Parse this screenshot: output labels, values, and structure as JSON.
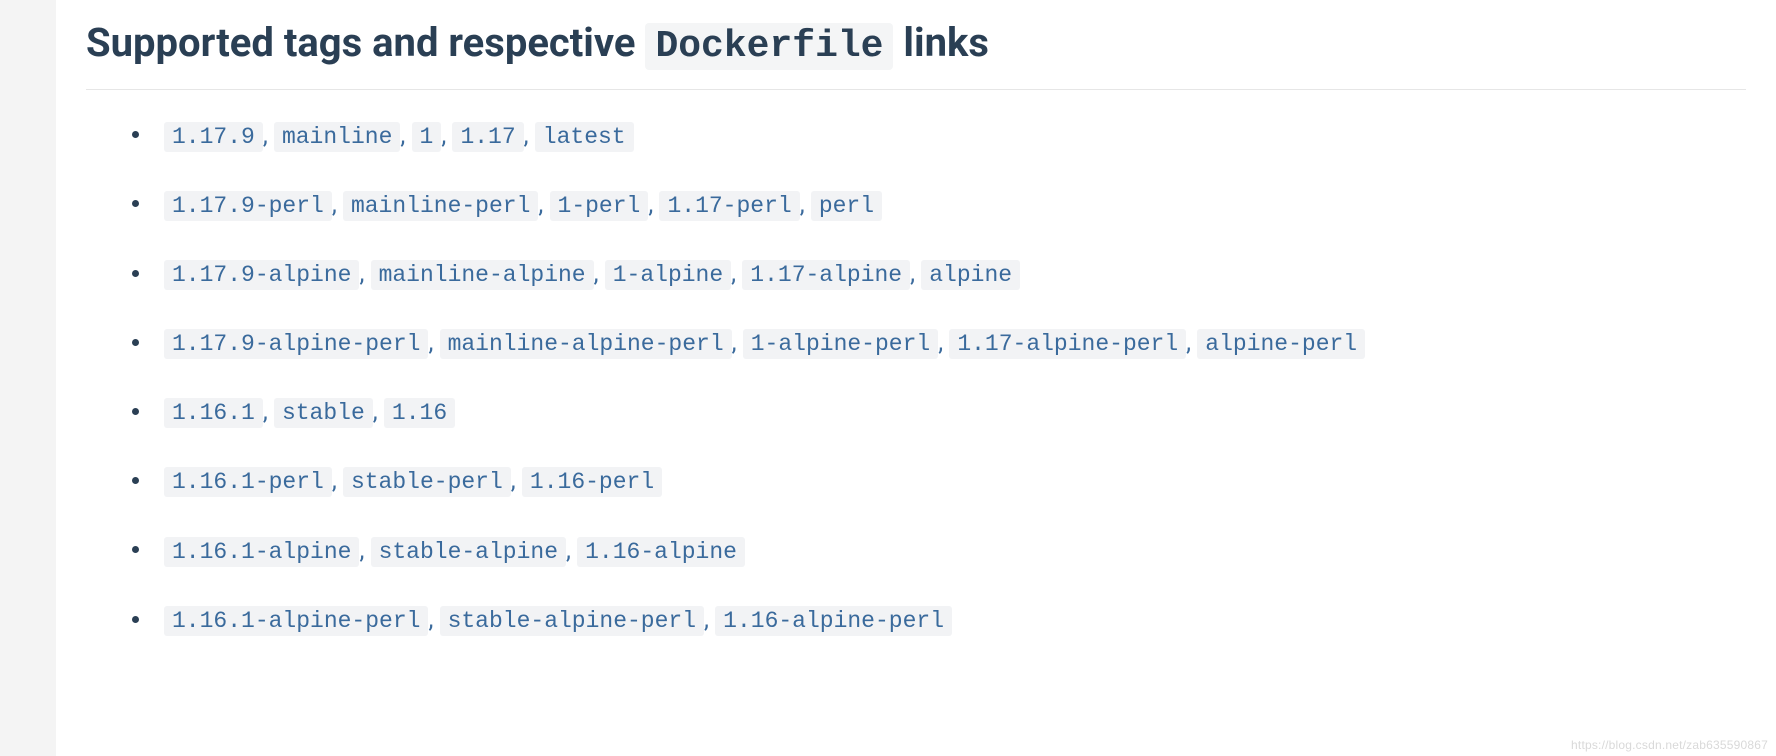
{
  "heading": {
    "prefix": "Supported tags and respective ",
    "code": "Dockerfile",
    "suffix": " links"
  },
  "tag_groups": [
    [
      "1.17.9",
      "mainline",
      "1",
      "1.17",
      "latest"
    ],
    [
      "1.17.9-perl",
      "mainline-perl",
      "1-perl",
      "1.17-perl",
      "perl"
    ],
    [
      "1.17.9-alpine",
      "mainline-alpine",
      "1-alpine",
      "1.17-alpine",
      "alpine"
    ],
    [
      "1.17.9-alpine-perl",
      "mainline-alpine-perl",
      "1-alpine-perl",
      "1.17-alpine-perl",
      "alpine-perl"
    ],
    [
      "1.16.1",
      "stable",
      "1.16"
    ],
    [
      "1.16.1-perl",
      "stable-perl",
      "1.16-perl"
    ],
    [
      "1.16.1-alpine",
      "stable-alpine",
      "1.16-alpine"
    ],
    [
      "1.16.1-alpine-perl",
      "stable-alpine-perl",
      "1.16-alpine-perl"
    ]
  ],
  "separator": ", ",
  "watermark": "https://blog.csdn.net/zab635590867"
}
